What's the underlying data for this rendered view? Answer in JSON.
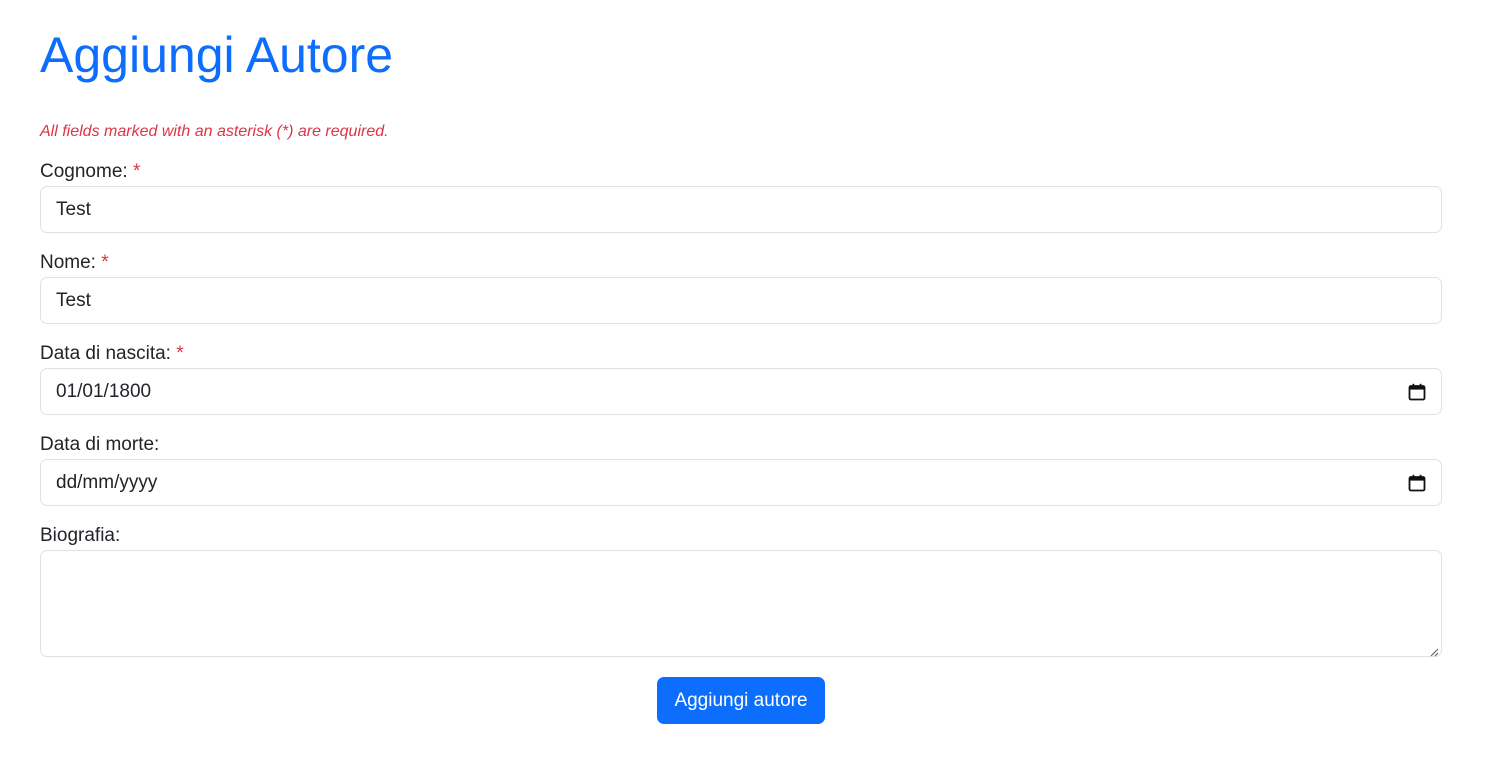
{
  "page": {
    "title": "Aggiungi Autore",
    "required_note": "All fields marked with an asterisk (*) are required."
  },
  "form": {
    "required_marker": "*",
    "cognome": {
      "label": "Cognome:",
      "value": "Test",
      "required": true
    },
    "nome": {
      "label": "Nome:",
      "value": "Test",
      "required": true
    },
    "data_nascita": {
      "label": "Data di nascita:",
      "value": "01/01/1800",
      "required": true,
      "icon": "calendar-icon"
    },
    "data_morte": {
      "label": "Data di morte:",
      "placeholder": "dd/mm/yyyy",
      "required": false,
      "icon": "calendar-icon"
    },
    "biografia": {
      "label": "Biografia:",
      "value": ""
    },
    "submit_label": "Aggiungi autore"
  },
  "colors": {
    "primary": "#0d6efd",
    "required": "#dc3545",
    "border": "#dee2e6",
    "text": "#212529"
  }
}
